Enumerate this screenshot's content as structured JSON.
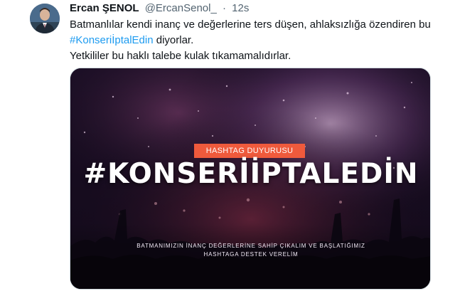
{
  "tweet": {
    "author_name": "Ercan ŞENOL",
    "author_handle": "@ErcanSenol_",
    "separator": "·",
    "timestamp": "12s",
    "avatar_icon": "profile-photo",
    "text_line1": "Batmanlılar kendi inanç ve değerlerine ters düşen, ahlaksızlığa özendiren bu",
    "hashtag": "#KonseriİptalEdin",
    "text_line2_rest": " diyorlar.",
    "text_line3": "Yetkililer bu haklı talebe kulak tıkamamalıdırlar.",
    "accent_color": "#1d9bf0"
  },
  "media": {
    "badge": "HASHTAG DUYURUSU",
    "big_hashtag": "#KONSERİİPTALEDİN",
    "subtitle_line1": "BATMANIMIZIN İNANÇ DEĞERLERİNE SAHİP ÇIKALIM VE BAŞLATIĞIMIZ",
    "subtitle_line2": "HASHTAGA DESTEK VERELİM",
    "badge_color": "#ef5a3c"
  }
}
